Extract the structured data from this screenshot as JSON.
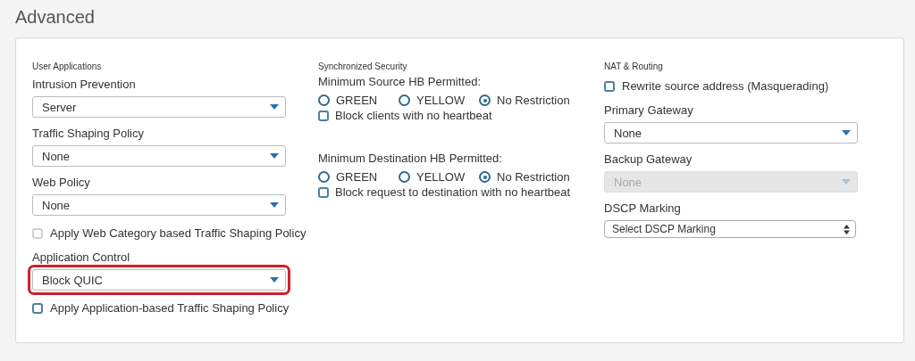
{
  "page_title": "Advanced",
  "columns": [
    {
      "items": [
        {
          "kind": "heading",
          "text": "User Applications"
        },
        {
          "kind": "label",
          "text": "Intrusion Prevention"
        },
        {
          "kind": "select",
          "value": "Server",
          "disabled": false
        },
        {
          "kind": "label",
          "text": "Traffic Shaping Policy"
        },
        {
          "kind": "select",
          "value": "None",
          "disabled": false
        },
        {
          "kind": "label",
          "text": "Web Policy"
        },
        {
          "kind": "select",
          "value": "None",
          "disabled": false
        },
        {
          "kind": "checkbox",
          "text": "Apply Web Category based Traffic Shaping Policy",
          "checked": false
        },
        {
          "kind": "label",
          "text": "Application Control"
        },
        {
          "kind": "select",
          "value": "Block QUIC",
          "disabled": false,
          "highlighted": true
        },
        {
          "kind": "checkbox",
          "text": "Apply Application-based Traffic Shaping Policy",
          "checked": false
        }
      ]
    },
    {
      "items": [
        {
          "kind": "heading",
          "text": "Synchronized Security"
        },
        {
          "kind": "hb_group",
          "text": "Minimum Source HB Permitted:",
          "options": [
            {
              "label": "GREEN",
              "selected": false
            },
            {
              "label": "YELLOW",
              "selected": false
            },
            {
              "label": "No Restriction",
              "selected": true
            }
          ],
          "checkbox": {
            "text": "Block clients with no heartbeat",
            "checked": false
          }
        },
        {
          "kind": "hb_group",
          "text": "Minimum Destination HB Permitted:",
          "options": [
            {
              "label": "GREEN",
              "selected": false
            },
            {
              "label": "YELLOW",
              "selected": false
            },
            {
              "label": "No Restriction",
              "selected": true
            }
          ],
          "checkbox": {
            "text": "Block request to destination with no heartbeat",
            "checked": false
          }
        }
      ]
    },
    {
      "items": [
        {
          "kind": "heading",
          "text": "NAT & Routing"
        },
        {
          "kind": "checkbox",
          "text": "Rewrite source address (Masquerading)",
          "checked": false
        },
        {
          "kind": "label",
          "text": "Primary Gateway"
        },
        {
          "kind": "select",
          "value": "None",
          "disabled": false
        },
        {
          "kind": "label",
          "text": "Backup Gateway"
        },
        {
          "kind": "select",
          "value": "None",
          "disabled": true
        },
        {
          "kind": "label",
          "text": "DSCP Marking"
        },
        {
          "kind": "native_select",
          "value": "Select DSCP Marking"
        }
      ]
    }
  ]
}
